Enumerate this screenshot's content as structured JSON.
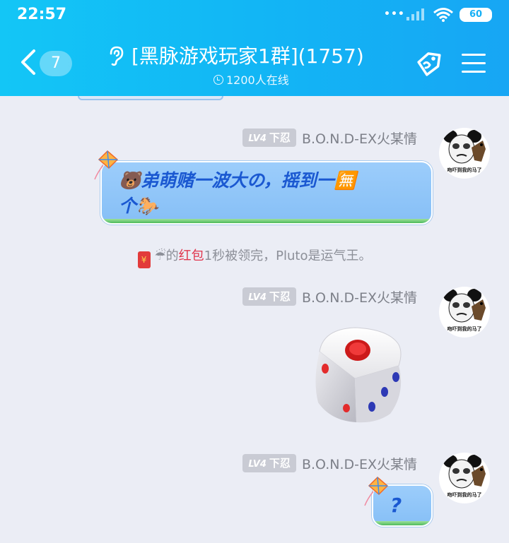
{
  "status_bar": {
    "time": "22:57",
    "dots": "•••",
    "battery": "60"
  },
  "header": {
    "unread_count": "7",
    "title": "[黑脉游戏玩家1群](1757)",
    "online": "1200人在线"
  },
  "messages": [
    {
      "level": "LV4",
      "rank": "下忍",
      "sender": "B.O.N.D-EX火某情",
      "avatar_caption": "吻吓到我的马了",
      "text_line1": "🐻弟萌赌一波大の，摇到一🈚",
      "text_line2": "个🐎"
    },
    {
      "level": "LV4",
      "rank": "下忍",
      "sender": "B.O.N.D-EX火某情",
      "avatar_caption": "吻吓到我的马了"
    },
    {
      "level": "LV4",
      "rank": "下忍",
      "sender": "B.O.N.D-EX火某情",
      "avatar_caption": "吻吓到我的马了",
      "text": "?"
    }
  ],
  "system": {
    "emoji": "☔",
    "prefix": "的",
    "link": "红包",
    "suffix": "1秒被领完，Pluto是运气王。"
  },
  "colors": {
    "header": "#13bcf5",
    "bubble_text": "#1a58d1",
    "link": "#e0344c"
  }
}
